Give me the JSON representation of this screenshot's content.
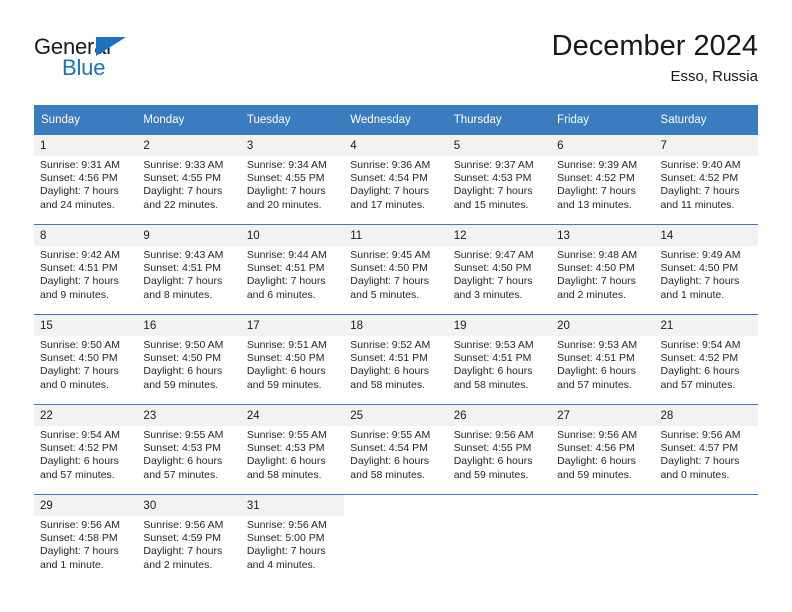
{
  "brand": {
    "name_part1": "General",
    "name_part2": "Blue",
    "accent_color": "#1c72bd"
  },
  "header": {
    "title": "December 2024",
    "subtitle": "Esso, Russia"
  },
  "theme": {
    "header_bg": "#3a7cbe",
    "daynum_bg": "#f2f2f2",
    "text_color": "#1a1a1a"
  },
  "weekday_headers": [
    "Sunday",
    "Monday",
    "Tuesday",
    "Wednesday",
    "Thursday",
    "Friday",
    "Saturday"
  ],
  "weeks": [
    [
      {
        "day": "1",
        "sunrise": "Sunrise: 9:31 AM",
        "sunset": "Sunset: 4:56 PM",
        "daylight_line1": "Daylight: 7 hours",
        "daylight_line2": "and 24 minutes."
      },
      {
        "day": "2",
        "sunrise": "Sunrise: 9:33 AM",
        "sunset": "Sunset: 4:55 PM",
        "daylight_line1": "Daylight: 7 hours",
        "daylight_line2": "and 22 minutes."
      },
      {
        "day": "3",
        "sunrise": "Sunrise: 9:34 AM",
        "sunset": "Sunset: 4:55 PM",
        "daylight_line1": "Daylight: 7 hours",
        "daylight_line2": "and 20 minutes."
      },
      {
        "day": "4",
        "sunrise": "Sunrise: 9:36 AM",
        "sunset": "Sunset: 4:54 PM",
        "daylight_line1": "Daylight: 7 hours",
        "daylight_line2": "and 17 minutes."
      },
      {
        "day": "5",
        "sunrise": "Sunrise: 9:37 AM",
        "sunset": "Sunset: 4:53 PM",
        "daylight_line1": "Daylight: 7 hours",
        "daylight_line2": "and 15 minutes."
      },
      {
        "day": "6",
        "sunrise": "Sunrise: 9:39 AM",
        "sunset": "Sunset: 4:52 PM",
        "daylight_line1": "Daylight: 7 hours",
        "daylight_line2": "and 13 minutes."
      },
      {
        "day": "7",
        "sunrise": "Sunrise: 9:40 AM",
        "sunset": "Sunset: 4:52 PM",
        "daylight_line1": "Daylight: 7 hours",
        "daylight_line2": "and 11 minutes."
      }
    ],
    [
      {
        "day": "8",
        "sunrise": "Sunrise: 9:42 AM",
        "sunset": "Sunset: 4:51 PM",
        "daylight_line1": "Daylight: 7 hours",
        "daylight_line2": "and 9 minutes."
      },
      {
        "day": "9",
        "sunrise": "Sunrise: 9:43 AM",
        "sunset": "Sunset: 4:51 PM",
        "daylight_line1": "Daylight: 7 hours",
        "daylight_line2": "and 8 minutes."
      },
      {
        "day": "10",
        "sunrise": "Sunrise: 9:44 AM",
        "sunset": "Sunset: 4:51 PM",
        "daylight_line1": "Daylight: 7 hours",
        "daylight_line2": "and 6 minutes."
      },
      {
        "day": "11",
        "sunrise": "Sunrise: 9:45 AM",
        "sunset": "Sunset: 4:50 PM",
        "daylight_line1": "Daylight: 7 hours",
        "daylight_line2": "and 5 minutes."
      },
      {
        "day": "12",
        "sunrise": "Sunrise: 9:47 AM",
        "sunset": "Sunset: 4:50 PM",
        "daylight_line1": "Daylight: 7 hours",
        "daylight_line2": "and 3 minutes."
      },
      {
        "day": "13",
        "sunrise": "Sunrise: 9:48 AM",
        "sunset": "Sunset: 4:50 PM",
        "daylight_line1": "Daylight: 7 hours",
        "daylight_line2": "and 2 minutes."
      },
      {
        "day": "14",
        "sunrise": "Sunrise: 9:49 AM",
        "sunset": "Sunset: 4:50 PM",
        "daylight_line1": "Daylight: 7 hours",
        "daylight_line2": "and 1 minute."
      }
    ],
    [
      {
        "day": "15",
        "sunrise": "Sunrise: 9:50 AM",
        "sunset": "Sunset: 4:50 PM",
        "daylight_line1": "Daylight: 7 hours",
        "daylight_line2": "and 0 minutes."
      },
      {
        "day": "16",
        "sunrise": "Sunrise: 9:50 AM",
        "sunset": "Sunset: 4:50 PM",
        "daylight_line1": "Daylight: 6 hours",
        "daylight_line2": "and 59 minutes."
      },
      {
        "day": "17",
        "sunrise": "Sunrise: 9:51 AM",
        "sunset": "Sunset: 4:50 PM",
        "daylight_line1": "Daylight: 6 hours",
        "daylight_line2": "and 59 minutes."
      },
      {
        "day": "18",
        "sunrise": "Sunrise: 9:52 AM",
        "sunset": "Sunset: 4:51 PM",
        "daylight_line1": "Daylight: 6 hours",
        "daylight_line2": "and 58 minutes."
      },
      {
        "day": "19",
        "sunrise": "Sunrise: 9:53 AM",
        "sunset": "Sunset: 4:51 PM",
        "daylight_line1": "Daylight: 6 hours",
        "daylight_line2": "and 58 minutes."
      },
      {
        "day": "20",
        "sunrise": "Sunrise: 9:53 AM",
        "sunset": "Sunset: 4:51 PM",
        "daylight_line1": "Daylight: 6 hours",
        "daylight_line2": "and 57 minutes."
      },
      {
        "day": "21",
        "sunrise": "Sunrise: 9:54 AM",
        "sunset": "Sunset: 4:52 PM",
        "daylight_line1": "Daylight: 6 hours",
        "daylight_line2": "and 57 minutes."
      }
    ],
    [
      {
        "day": "22",
        "sunrise": "Sunrise: 9:54 AM",
        "sunset": "Sunset: 4:52 PM",
        "daylight_line1": "Daylight: 6 hours",
        "daylight_line2": "and 57 minutes."
      },
      {
        "day": "23",
        "sunrise": "Sunrise: 9:55 AM",
        "sunset": "Sunset: 4:53 PM",
        "daylight_line1": "Daylight: 6 hours",
        "daylight_line2": "and 57 minutes."
      },
      {
        "day": "24",
        "sunrise": "Sunrise: 9:55 AM",
        "sunset": "Sunset: 4:53 PM",
        "daylight_line1": "Daylight: 6 hours",
        "daylight_line2": "and 58 minutes."
      },
      {
        "day": "25",
        "sunrise": "Sunrise: 9:55 AM",
        "sunset": "Sunset: 4:54 PM",
        "daylight_line1": "Daylight: 6 hours",
        "daylight_line2": "and 58 minutes."
      },
      {
        "day": "26",
        "sunrise": "Sunrise: 9:56 AM",
        "sunset": "Sunset: 4:55 PM",
        "daylight_line1": "Daylight: 6 hours",
        "daylight_line2": "and 59 minutes."
      },
      {
        "day": "27",
        "sunrise": "Sunrise: 9:56 AM",
        "sunset": "Sunset: 4:56 PM",
        "daylight_line1": "Daylight: 6 hours",
        "daylight_line2": "and 59 minutes."
      },
      {
        "day": "28",
        "sunrise": "Sunrise: 9:56 AM",
        "sunset": "Sunset: 4:57 PM",
        "daylight_line1": "Daylight: 7 hours",
        "daylight_line2": "and 0 minutes."
      }
    ],
    [
      {
        "day": "29",
        "sunrise": "Sunrise: 9:56 AM",
        "sunset": "Sunset: 4:58 PM",
        "daylight_line1": "Daylight: 7 hours",
        "daylight_line2": "and 1 minute."
      },
      {
        "day": "30",
        "sunrise": "Sunrise: 9:56 AM",
        "sunset": "Sunset: 4:59 PM",
        "daylight_line1": "Daylight: 7 hours",
        "daylight_line2": "and 2 minutes."
      },
      {
        "day": "31",
        "sunrise": "Sunrise: 9:56 AM",
        "sunset": "Sunset: 5:00 PM",
        "daylight_line1": "Daylight: 7 hours",
        "daylight_line2": "and 4 minutes."
      },
      {
        "day": "",
        "sunrise": "",
        "sunset": "",
        "daylight_line1": "",
        "daylight_line2": ""
      },
      {
        "day": "",
        "sunrise": "",
        "sunset": "",
        "daylight_line1": "",
        "daylight_line2": ""
      },
      {
        "day": "",
        "sunrise": "",
        "sunset": "",
        "daylight_line1": "",
        "daylight_line2": ""
      },
      {
        "day": "",
        "sunrise": "",
        "sunset": "",
        "daylight_line1": "",
        "daylight_line2": ""
      }
    ]
  ]
}
